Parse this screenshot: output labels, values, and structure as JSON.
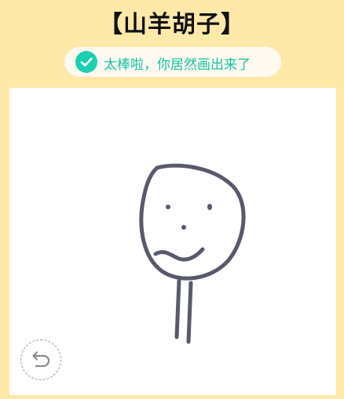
{
  "header": {
    "title": "【山羊胡子】"
  },
  "result": {
    "icon": "check-icon",
    "message": "太棒啦，你居然画出来了",
    "accent_color": "#19d1b0"
  },
  "canvas": {
    "drawing_subject": "stick figure face with goatee",
    "stroke_color": "#585a6c",
    "undo_icon": "undo-icon"
  },
  "colors": {
    "background": "#ffe9a9",
    "panel": "#ffffff"
  }
}
